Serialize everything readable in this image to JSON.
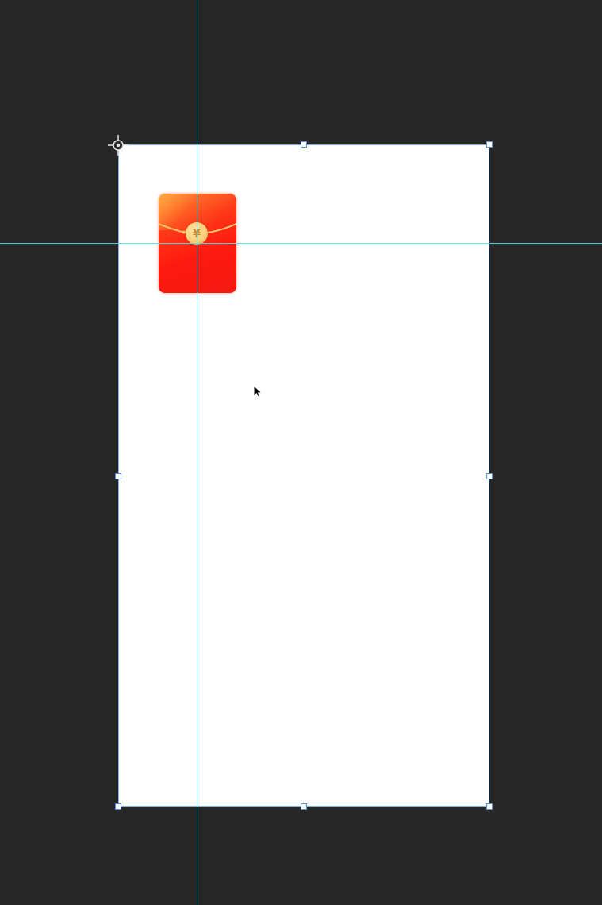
{
  "workspace": {
    "background_color": "#272727",
    "guide_color": "#4fe3f0",
    "handle_border_color": "#5a8ed6"
  },
  "artboard": {
    "background_color": "#ffffff",
    "border_color": "#7fb0e8"
  },
  "red_envelope": {
    "icon": "red-envelope-icon",
    "primary_color": "#ff1a10",
    "accent_color": "#ff7a2a",
    "coin_color": "#f7cf7a",
    "coin_symbol": "¥"
  },
  "tools": {
    "origin_marker_icon": "crosshair-icon",
    "pointer_icon": "arrow-cursor-icon"
  }
}
